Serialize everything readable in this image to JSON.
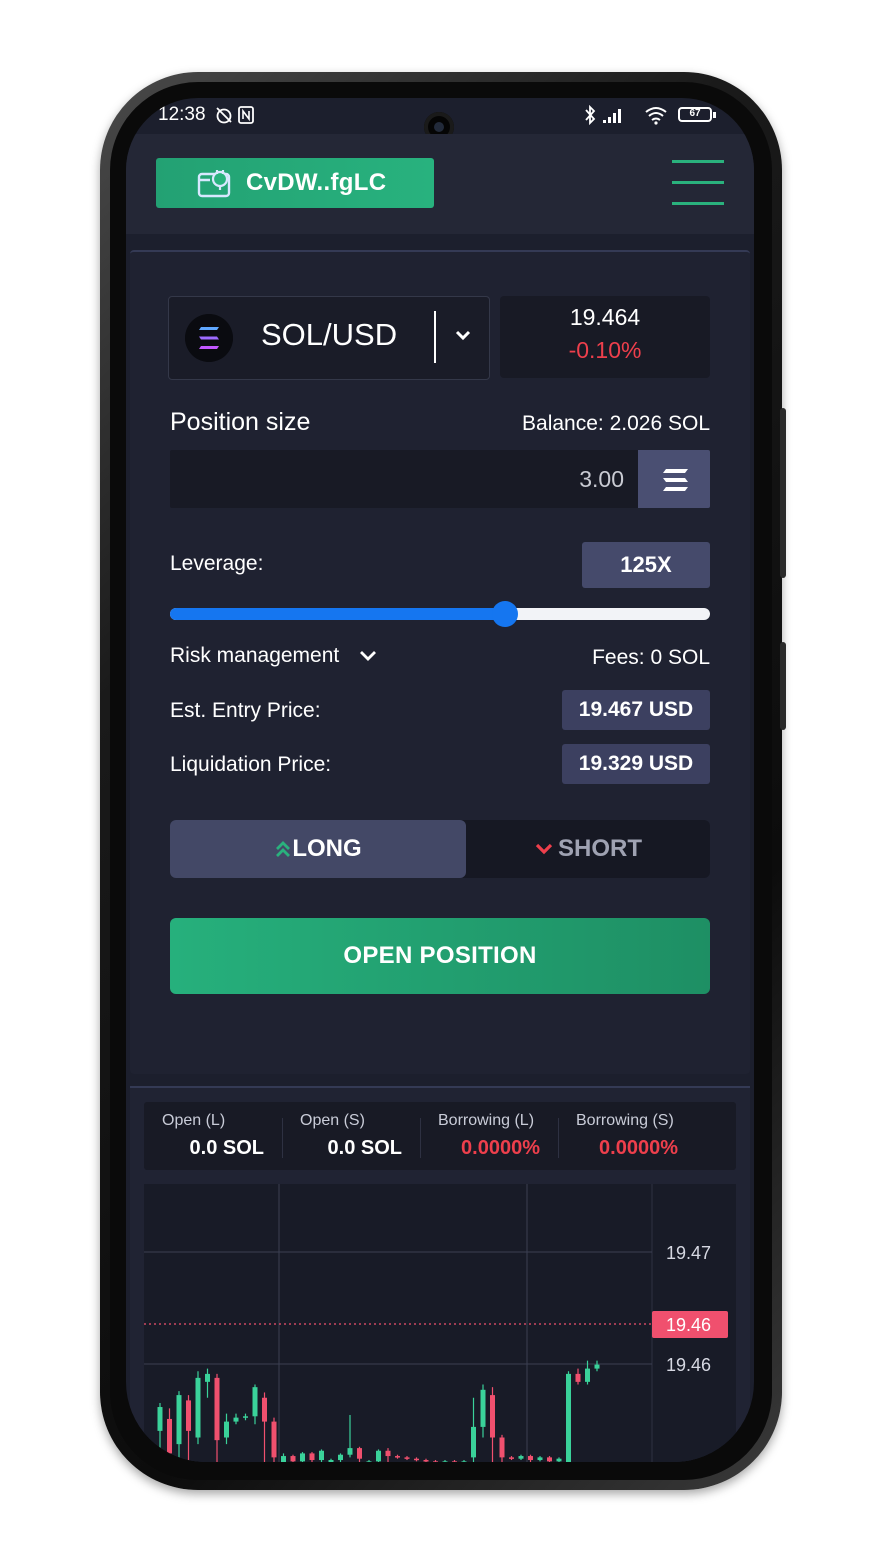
{
  "status_bar": {
    "time": "12:38",
    "battery": "67"
  },
  "header": {
    "wallet_label": "CvDW..fgLC"
  },
  "trade": {
    "pair": "SOL/USD",
    "price": "19.464",
    "change": "-0.10%",
    "position_size_label": "Position size",
    "balance": "Balance: 2.026 SOL",
    "size_value": "3.00",
    "leverage_label": "Leverage:",
    "leverage_value": "125X",
    "leverage_fraction": 0.62,
    "risk_label": "Risk management",
    "fees": "Fees: 0 SOL",
    "entry_label": "Est. Entry Price:",
    "entry_value": "19.467 USD",
    "liq_label": "Liquidation Price:",
    "liq_value": "19.329 USD",
    "long_label": "LONG",
    "short_label": "SHORT",
    "open_label": "OPEN POSITION"
  },
  "stats": [
    {
      "label": "Open (L)",
      "value": "0.0 SOL"
    },
    {
      "label": "Open (S)",
      "value": "0.0 SOL"
    },
    {
      "label": "Borrowing (L)",
      "value": "0.0000%"
    },
    {
      "label": "Borrowing (S)",
      "value": "0.0000%"
    }
  ],
  "colors": {
    "accent_green": "#28b27e",
    "negative_red": "#ee3f4c",
    "slider_blue": "#1576f0",
    "candle_up": "#3ad29a",
    "candle_down": "#f0506e"
  },
  "chart_data": {
    "type": "candlestick",
    "title": "",
    "price_labels": [
      "19.47",
      "19.46",
      "19.46"
    ],
    "current_price_tag": "19.46",
    "candles": [
      {
        "o": 19.4565,
        "c": 19.4583,
        "h": 19.4586,
        "l": 19.454
      },
      {
        "o": 19.4574,
        "c": 19.4548,
        "h": 19.4582,
        "l": 19.454
      },
      {
        "o": 19.4555,
        "c": 19.4592,
        "h": 19.4595,
        "l": 19.454
      },
      {
        "o": 19.4588,
        "c": 19.4565,
        "h": 19.4592,
        "l": 19.454
      },
      {
        "o": 19.456,
        "c": 19.4605,
        "h": 19.461,
        "l": 19.4555
      },
      {
        "o": 19.4602,
        "c": 19.4608,
        "h": 19.4612,
        "l": 19.459
      },
      {
        "o": 19.4605,
        "c": 19.4558,
        "h": 19.4608,
        "l": 19.454
      },
      {
        "o": 19.456,
        "c": 19.4572,
        "h": 19.4578,
        "l": 19.4555
      },
      {
        "o": 19.4572,
        "c": 19.4575,
        "h": 19.4578,
        "l": 19.457
      },
      {
        "o": 19.4575,
        "c": 19.4576,
        "h": 19.4578,
        "l": 19.4573
      },
      {
        "o": 19.4576,
        "c": 19.4598,
        "h": 19.46,
        "l": 19.457
      },
      {
        "o": 19.459,
        "c": 19.4572,
        "h": 19.4594,
        "l": 19.454
      },
      {
        "o": 19.4572,
        "c": 19.4545,
        "h": 19.4575,
        "l": 19.454
      },
      {
        "o": 19.454,
        "c": 19.4546,
        "h": 19.4548,
        "l": 19.454
      },
      {
        "o": 19.4546,
        "c": 19.4542,
        "h": 19.4547,
        "l": 19.454
      },
      {
        "o": 19.4542,
        "c": 19.4548,
        "h": 19.4549,
        "l": 19.454
      },
      {
        "o": 19.4548,
        "c": 19.4543,
        "h": 19.4549,
        "l": 19.454
      },
      {
        "o": 19.4543,
        "c": 19.455,
        "h": 19.4551,
        "l": 19.454
      },
      {
        "o": 19.454,
        "c": 19.4543,
        "h": 19.4544,
        "l": 19.454
      },
      {
        "o": 19.4543,
        "c": 19.4547,
        "h": 19.4548,
        "l": 19.4541
      },
      {
        "o": 19.4547,
        "c": 19.4552,
        "h": 19.4577,
        "l": 19.4545
      },
      {
        "o": 19.4552,
        "c": 19.4544,
        "h": 19.4553,
        "l": 19.454
      },
      {
        "o": 19.454,
        "c": 19.4542,
        "h": 19.4543,
        "l": 19.454
      },
      {
        "o": 19.4542,
        "c": 19.455,
        "h": 19.4551,
        "l": 19.4541
      },
      {
        "o": 19.455,
        "c": 19.4546,
        "h": 19.4552,
        "l": 19.454
      },
      {
        "o": 19.4546,
        "c": 19.4545,
        "h": 19.4547,
        "l": 19.4544
      },
      {
        "o": 19.4545,
        "c": 19.4544,
        "h": 19.4546,
        "l": 19.4543
      },
      {
        "o": 19.4544,
        "c": 19.4543,
        "h": 19.4545,
        "l": 19.4542
      },
      {
        "o": 19.4543,
        "c": 19.4542,
        "h": 19.4544,
        "l": 19.4541
      },
      {
        "o": 19.4542,
        "c": 19.4541,
        "h": 19.4543,
        "l": 19.454
      },
      {
        "o": 19.4541,
        "c": 19.4542,
        "h": 19.4543,
        "l": 19.454
      },
      {
        "o": 19.4542,
        "c": 19.4541,
        "h": 19.4543,
        "l": 19.454
      },
      {
        "o": 19.4541,
        "c": 19.4542,
        "h": 19.4543,
        "l": 19.454
      },
      {
        "o": 19.4545,
        "c": 19.4568,
        "h": 19.459,
        "l": 19.454
      },
      {
        "o": 19.4568,
        "c": 19.4596,
        "h": 19.46,
        "l": 19.456
      },
      {
        "o": 19.4592,
        "c": 19.456,
        "h": 19.4598,
        "l": 19.454
      },
      {
        "o": 19.456,
        "c": 19.4545,
        "h": 19.4562,
        "l": 19.454
      },
      {
        "o": 19.4545,
        "c": 19.4544,
        "h": 19.4546,
        "l": 19.4543
      },
      {
        "o": 19.4544,
        "c": 19.4546,
        "h": 19.4547,
        "l": 19.4543
      },
      {
        "o": 19.4546,
        "c": 19.4543,
        "h": 19.4547,
        "l": 19.454
      },
      {
        "o": 19.4543,
        "c": 19.4545,
        "h": 19.4546,
        "l": 19.4542
      },
      {
        "o": 19.4545,
        "c": 19.4542,
        "h": 19.4546,
        "l": 19.454
      },
      {
        "o": 19.4542,
        "c": 19.4544,
        "h": 19.4545,
        "l": 19.4541
      },
      {
        "o": 19.454,
        "c": 19.4608,
        "h": 19.461,
        "l": 19.454
      },
      {
        "o": 19.4608,
        "c": 19.4602,
        "h": 19.4612,
        "l": 19.46
      },
      {
        "o": 19.4602,
        "c": 19.4612,
        "h": 19.4618,
        "l": 19.46
      },
      {
        "o": 19.4612,
        "c": 19.4615,
        "h": 19.4618,
        "l": 19.461
      }
    ]
  }
}
